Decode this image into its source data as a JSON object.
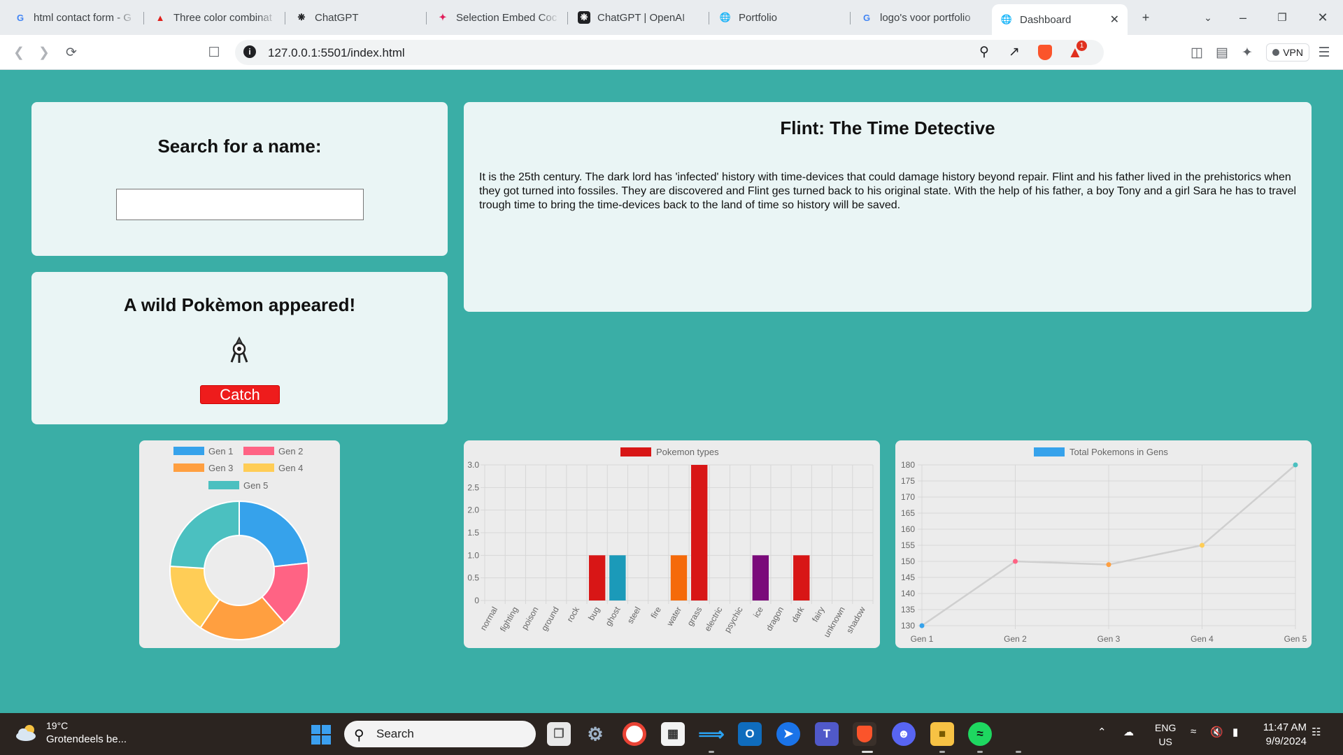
{
  "browser": {
    "tabs": [
      {
        "label": "html contact form - G",
        "icon": "google-icon"
      },
      {
        "label": "Three color combinat",
        "icon": "adobe-icon"
      },
      {
        "label": "ChatGPT",
        "icon": "openai-icon"
      },
      {
        "label": "Selection Embed Coc",
        "icon": "slack-icon"
      },
      {
        "label": "ChatGPT | OpenAI",
        "icon": "openai-icon"
      },
      {
        "label": "Portfolio",
        "icon": "globe-icon"
      },
      {
        "label": "logo's voor portfolio",
        "icon": "google-icon"
      },
      {
        "label": "Dashboard",
        "icon": "globe-icon"
      }
    ],
    "url": "127.0.0.1:5501/index.html",
    "vpn_label": "VPN",
    "brave_badge": "1"
  },
  "search": {
    "title": "Search for a name:",
    "input_value": "",
    "placeholder": ""
  },
  "pokemon": {
    "title": "A wild Pokèmon appeared!",
    "catch_label": "Catch"
  },
  "story": {
    "title": "Flint: The Time Detective",
    "text": "It is the 25th century. The dark lord has 'infected' history with time-devices that could damage history beyond repair. Flint and his father lived in the prehistorics when they got turned into fossiles. They are discovered and Flint ges turned back to his original state. With the help of his father, a boy Tony and a girl Sara he has to travel trough time to bring the time-devices back to the land of time so history will be saved."
  },
  "chart_data": [
    {
      "type": "pie",
      "style": "doughnut",
      "categories": [
        "Gen 1",
        "Gen 2",
        "Gen 3",
        "Gen 4",
        "Gen 5"
      ],
      "values": [
        151,
        100,
        135,
        107,
        156
      ],
      "colors": [
        "#36a2eb",
        "#ff6384",
        "#ff9f40",
        "#ffcd56",
        "#4bc0c0"
      ],
      "legend": "top"
    },
    {
      "type": "bar",
      "categories": [
        "normal",
        "fighting",
        "poison",
        "ground",
        "rock",
        "bug",
        "ghost",
        "steel",
        "fire",
        "water",
        "grass",
        "electric",
        "psychic",
        "ice",
        "dragon",
        "dark",
        "fairy",
        "unknown",
        "shadow"
      ],
      "series": [
        {
          "name": "Pokemon types",
          "values": [
            0,
            0,
            0,
            0,
            0,
            1,
            1,
            0,
            0,
            1,
            3,
            0,
            0,
            1,
            0,
            1,
            0,
            0,
            0
          ]
        }
      ],
      "bar_colors": [
        "#d81616",
        "#d81616",
        "#d81616",
        "#d81616",
        "#d81616",
        "#d81616",
        "#1b9ab9",
        "#d81616",
        "#d81616",
        "#f56a0a",
        "#d81616",
        "#d81616",
        "#d81616",
        "#7a0a7a",
        "#d81616",
        "#d81616",
        "#d81616",
        "#d81616",
        "#d81616"
      ],
      "legend_color": "#d81616",
      "ylim": [
        0,
        3
      ],
      "yticks": [
        "0",
        "0.5",
        "1.0",
        "1.5",
        "2.0",
        "2.5",
        "3.0"
      ],
      "grid": true,
      "legend": "top"
    },
    {
      "type": "line",
      "categories": [
        "Gen 1",
        "Gen 2",
        "Gen 3",
        "Gen 4",
        "Gen 5"
      ],
      "series": [
        {
          "name": "Total Pokemons in Gens",
          "values": [
            130,
            150,
            149,
            155,
            180
          ]
        }
      ],
      "point_colors": [
        "#36a2eb",
        "#ff6384",
        "#ff9f40",
        "#ffcd56",
        "#4bc0c0"
      ],
      "line_color": "#cfcfcf",
      "legend_color": "#36a2eb",
      "ylim": [
        130,
        180
      ],
      "yticks": [
        "130",
        "135",
        "140",
        "145",
        "150",
        "155",
        "160",
        "165",
        "170",
        "175",
        "180"
      ],
      "grid": true,
      "legend": "top"
    }
  ],
  "taskbar": {
    "weather_temp": "19°C",
    "weather_desc": "Grotendeels be...",
    "search_label": "Search",
    "lang": "ENG",
    "region": "US",
    "time": "11:47 AM",
    "date": "9/9/2024"
  }
}
